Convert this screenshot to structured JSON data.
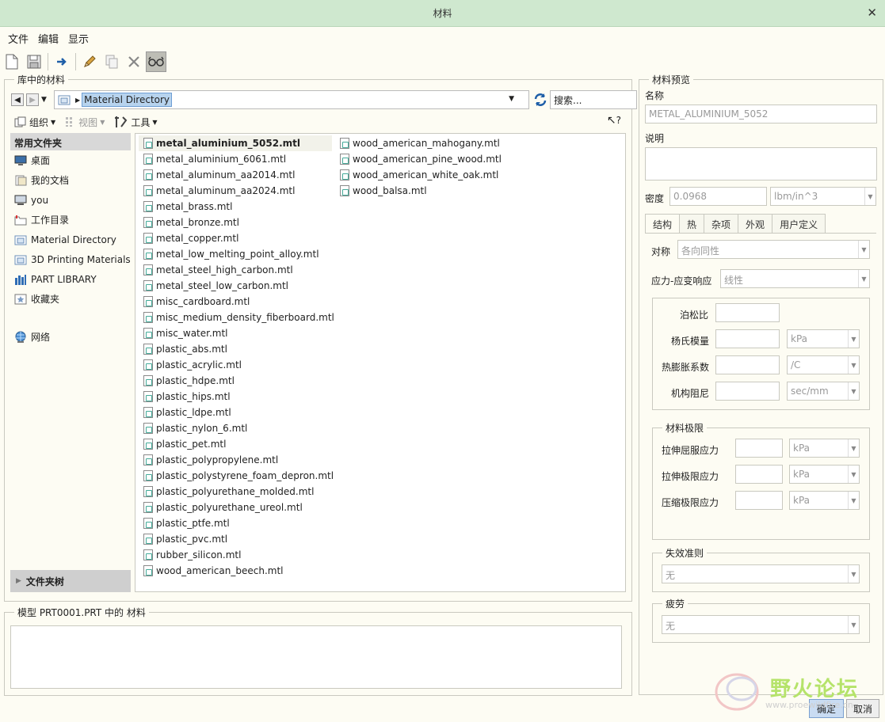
{
  "window": {
    "title": "材料",
    "close_glyph": "✕"
  },
  "menu": [
    "文件",
    "编辑",
    "显示"
  ],
  "library": {
    "legend": "库中的材料",
    "address": "Material Directory",
    "search_placeholder": "搜索...",
    "view": {
      "organize": "组织",
      "views": "视图",
      "tools": "工具"
    },
    "help_glyph": "?",
    "sidebar": {
      "header": "常用文件夹",
      "items": [
        "桌面",
        "我的文档",
        "you",
        "工作目录",
        "Material Directory",
        "3D Printing Materials",
        "PART LIBRARY",
        "收藏夹"
      ],
      "network": "网络",
      "footer": "文件夹树"
    },
    "files_col1": [
      "metal_aluminium_5052.mtl",
      "metal_aluminium_6061.mtl",
      "metal_aluminum_aa2014.mtl",
      "metal_aluminum_aa2024.mtl",
      "metal_brass.mtl",
      "metal_bronze.mtl",
      "metal_copper.mtl",
      "metal_low_melting_point_alloy.mtl",
      "metal_steel_high_carbon.mtl",
      "metal_steel_low_carbon.mtl",
      "misc_cardboard.mtl",
      "misc_medium_density_fiberboard.mtl",
      "misc_water.mtl",
      "plastic_abs.mtl",
      "plastic_acrylic.mtl",
      "plastic_hdpe.mtl",
      "plastic_hips.mtl",
      "plastic_ldpe.mtl",
      "plastic_nylon_6.mtl",
      "plastic_pet.mtl",
      "plastic_polypropylene.mtl",
      "plastic_polystyrene_foam_depron.mtl",
      "plastic_polyurethane_molded.mtl",
      "plastic_polyurethane_ureol.mtl",
      "plastic_ptfe.mtl",
      "plastic_pvc.mtl",
      "rubber_silicon.mtl",
      "wood_american_beech.mtl"
    ],
    "files_col2": [
      "wood_american_mahogany.mtl",
      "wood_american_pine_wood.mtl",
      "wood_american_white_oak.mtl",
      "wood_balsa.mtl"
    ]
  },
  "model": {
    "legend": "模型 PRT0001.PRT 中的 材料"
  },
  "preview": {
    "legend": "材料预览",
    "name_label": "名称",
    "name_value": "METAL_ALUMINIUM_5052",
    "desc_label": "说明",
    "density_label": "密度",
    "density_value": "0.0968",
    "density_unit": "lbm/in^3",
    "tabs": [
      "结构",
      "热",
      "杂项",
      "外观",
      "用户定义"
    ],
    "symmetry_label": "对称",
    "symmetry_value": "各向同性",
    "response_label": "应力-应变响应",
    "response_value": "线性",
    "poisson_label": "泊松比",
    "youngs_label": "杨氏模量",
    "youngs_unit": "kPa",
    "thermal_label": "热膨胀系数",
    "thermal_unit": "/C",
    "damping_label": "机构阻尼",
    "damping_unit": "sec/mm",
    "limits_legend": "材料极限",
    "tensile_yield_label": "拉伸屈服应力",
    "tensile_yield_unit": "kPa",
    "tensile_ult_label": "拉伸极限应力",
    "tensile_ult_unit": "kPa",
    "compress_label": "压缩极限应力",
    "compress_unit": "kPa",
    "failure_legend": "失效准则",
    "failure_value": "无",
    "fatigue_legend": "疲劳",
    "fatigue_value": "无"
  },
  "buttons": {
    "ok": "确定",
    "cancel": "取消"
  },
  "watermark": {
    "text": "野火论坛",
    "sub": "www.proewildfire.cn"
  }
}
